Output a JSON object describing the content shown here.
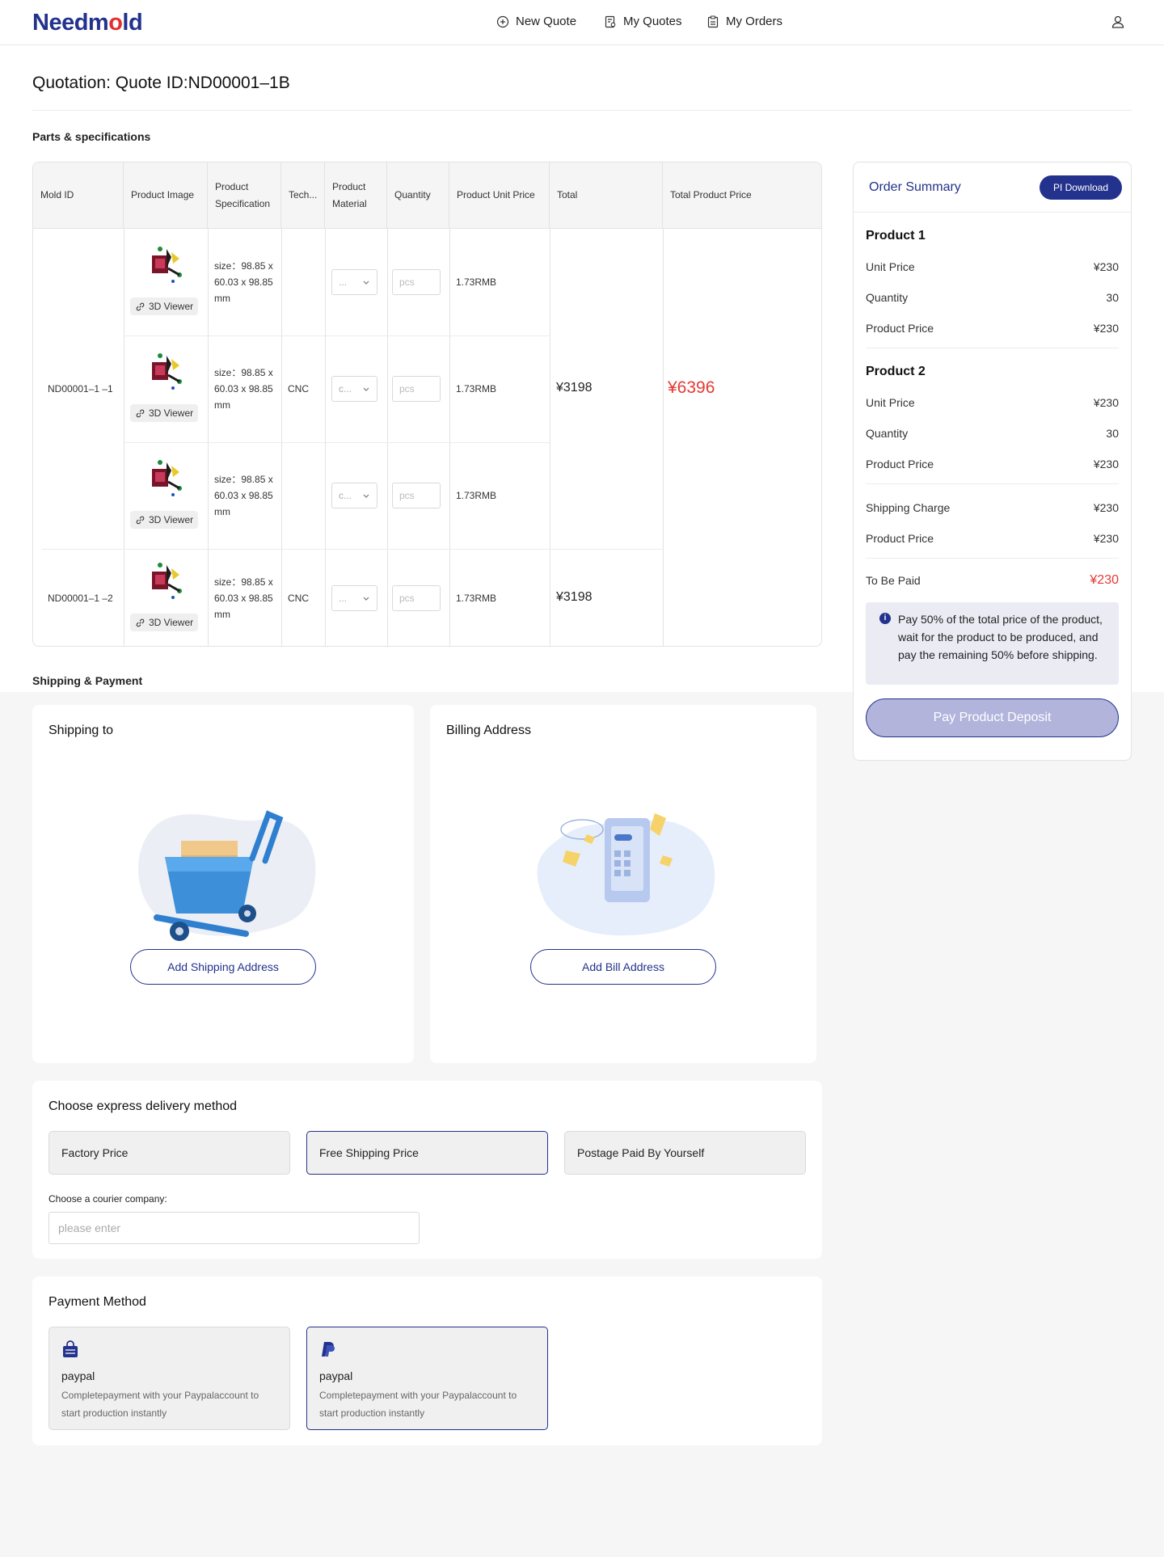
{
  "header": {
    "logo_left": "Needm",
    "logo_mid": "o",
    "logo_right": "ld",
    "nav": {
      "new_quote": "New Quote",
      "my_quotes": "My Quotes",
      "my_orders": "My Orders"
    }
  },
  "page": {
    "title": "Quotation: Quote ID:ND00001–1B"
  },
  "parts": {
    "section_title": "Parts & specifications",
    "columns": [
      "Mold ID",
      "Product Image",
      "Product Specification",
      "Tech...",
      "Product Material",
      "Quantity",
      "Product Unit Price",
      "Total",
      "Total Product Price"
    ],
    "viewer_label": "3D Viewer",
    "qty_placeholder": "pcs",
    "molds": [
      {
        "id": "ND00001–1 –1",
        "tech": "CNC",
        "total": "¥3198"
      },
      {
        "id": "ND00001–1 –2",
        "tech": "CNC",
        "total": "¥3198"
      }
    ],
    "rows": [
      {
        "spec": "size：98.85 x 60.03 x 98.85 mm",
        "material": "...",
        "unit_price": "1.73RMB"
      },
      {
        "spec": "size：98.85 x 60.03 x 98.85 mm",
        "material": "c...",
        "unit_price": "1.73RMB"
      },
      {
        "spec": "size：98.85 x 60.03 x 98.85 mm",
        "material": "c...",
        "unit_price": "1.73RMB"
      },
      {
        "spec": "size：98.85 x 60.03 x 98.85 mm",
        "material": "...",
        "unit_price": "1.73RMB"
      }
    ],
    "grand_total": "¥6396"
  },
  "shipping": {
    "section_title": "Shipping & Payment",
    "ship_to_title": "Shipping to",
    "add_ship": "Add Shipping Address",
    "billing_title": "Billing Address",
    "add_bill": "Add Bill Address"
  },
  "delivery": {
    "title": "Choose express delivery method",
    "options": [
      "Factory Price",
      "Free Shipping Price",
      "Postage Paid By Yourself"
    ],
    "selected_index": 1,
    "courier_label": "Choose a courier company:",
    "courier_placeholder": "please enter"
  },
  "payment": {
    "title": "Payment Method",
    "methods": [
      {
        "name": "paypal",
        "desc": "Completepayment with your Paypalaccount to start production instantly",
        "icon": "bag-icon"
      },
      {
        "name": "paypal",
        "desc": "Completepayment with your Paypalaccount to start production instantly",
        "icon": "paypal-icon"
      }
    ],
    "selected_index": 1
  },
  "summary": {
    "title": "Order Summary",
    "pi_download": "PI Download",
    "products": [
      {
        "name": "Product 1",
        "unit_label": "Unit Price",
        "unit": "¥230",
        "qty_label": "Quantity",
        "qty": "30",
        "price_label": "Product Price",
        "price": "¥230"
      },
      {
        "name": "Product 2",
        "unit_label": "Unit Price",
        "unit": "¥230",
        "qty_label": "Quantity",
        "qty": "30",
        "price_label": "Product Price",
        "price": "¥230"
      }
    ],
    "shipping_label": "Shipping Charge",
    "shipping": "¥230",
    "product_price_label": "Product Price",
    "product_price": "¥230",
    "to_be_paid_label": "To Be Paid",
    "to_be_paid": "¥230",
    "note": "Pay 50% of the total price of the product, wait for the product to be produced, and pay the remaining 50% before shipping.",
    "pay_button": "Pay Product Deposit"
  },
  "colors": {
    "brand": "#23328c",
    "price_red": "#e53935"
  }
}
